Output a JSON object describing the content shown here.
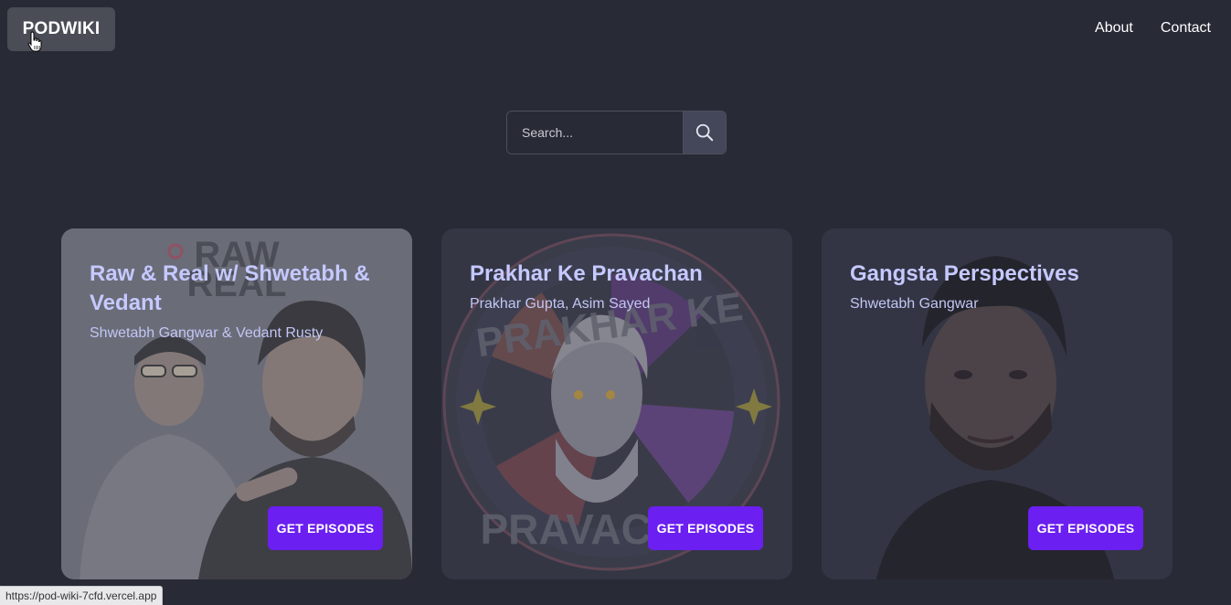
{
  "header": {
    "logo": "PODWIKI",
    "nav": [
      "About",
      "Contact"
    ]
  },
  "search": {
    "placeholder": "Search..."
  },
  "cards": [
    {
      "title": "Raw & Real w/ Shwetabh & Vedant",
      "subtitle": "Shwetabh Gangwar & Vedant Rusty",
      "art_text": "RAW REAL",
      "button": "GET EPISODES"
    },
    {
      "title": "Prakhar Ke Pravachan",
      "subtitle": "Prakhar Gupta, Asim Sayed",
      "art_text": [
        "PRAKHAR KE",
        "PRAVACHAN"
      ],
      "button": "GET EPISODES"
    },
    {
      "title": "Gangsta Perspectives",
      "subtitle": "Shwetabh Gangwar",
      "button": "GET EPISODES"
    }
  ],
  "status_bar": "https://pod-wiki-7cfd.vercel.app",
  "colors": {
    "background": "#282a36",
    "button": "#6b1ff0",
    "title": "#c5c9ff"
  },
  "icons": {
    "search": "search-icon",
    "cursor": "hand-cursor-icon"
  }
}
